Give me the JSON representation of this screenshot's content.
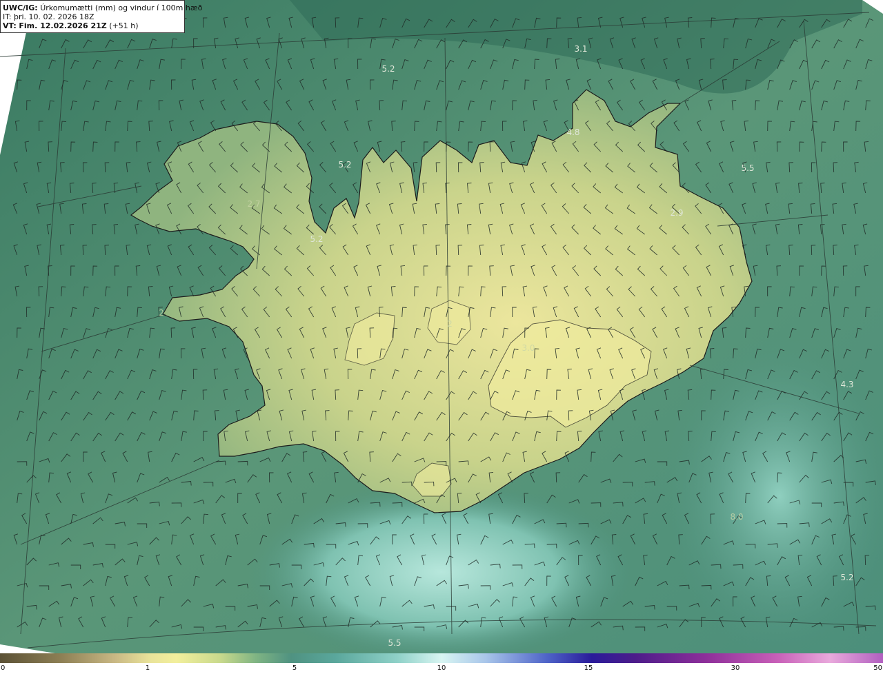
{
  "header": {
    "product": "UWC/IG:",
    "description": "Úrkomumætti (mm) og vindur í 100m hæð",
    "issue_time": "IT: þri. 10. 02. 2026 18Z",
    "valid_prefix": "VT:",
    "valid_time": "Fim. 12.02.2026 21Z",
    "lead_time": "(+51 h)"
  },
  "map_labels": [
    {
      "text": "3.1",
      "dim": false
    },
    {
      "text": "5.2",
      "dim": false
    },
    {
      "text": "4.8",
      "dim": false
    },
    {
      "text": "5.2",
      "dim": false
    },
    {
      "text": "5.5",
      "dim": false
    },
    {
      "text": "2.7",
      "dim": true
    },
    {
      "text": "2.9",
      "dim": false
    },
    {
      "text": "5.2",
      "dim": false
    },
    {
      "text": "4.3",
      "dim": false
    },
    {
      "text": "8.0",
      "dim": true
    },
    {
      "text": "5.2",
      "dim": false
    },
    {
      "text": "5.5",
      "dim": false
    },
    {
      "text": "2",
      "dim": true
    },
    {
      "text": "2",
      "dim": true
    },
    {
      "text": "3.0",
      "dim": true
    }
  ],
  "colorbar": {
    "ticks": [
      "0",
      "1",
      "5",
      "10",
      "15",
      "30",
      "50"
    ]
  },
  "colors": {
    "ocean_dark": "#3f7a62",
    "ocean_mid": "#4f9281",
    "land_low": "#c6d38a",
    "land_high": "#e6e29a",
    "storm_light": "#9fd9cc",
    "coast": "#1c1c1c",
    "barb": "#1f2a26"
  }
}
